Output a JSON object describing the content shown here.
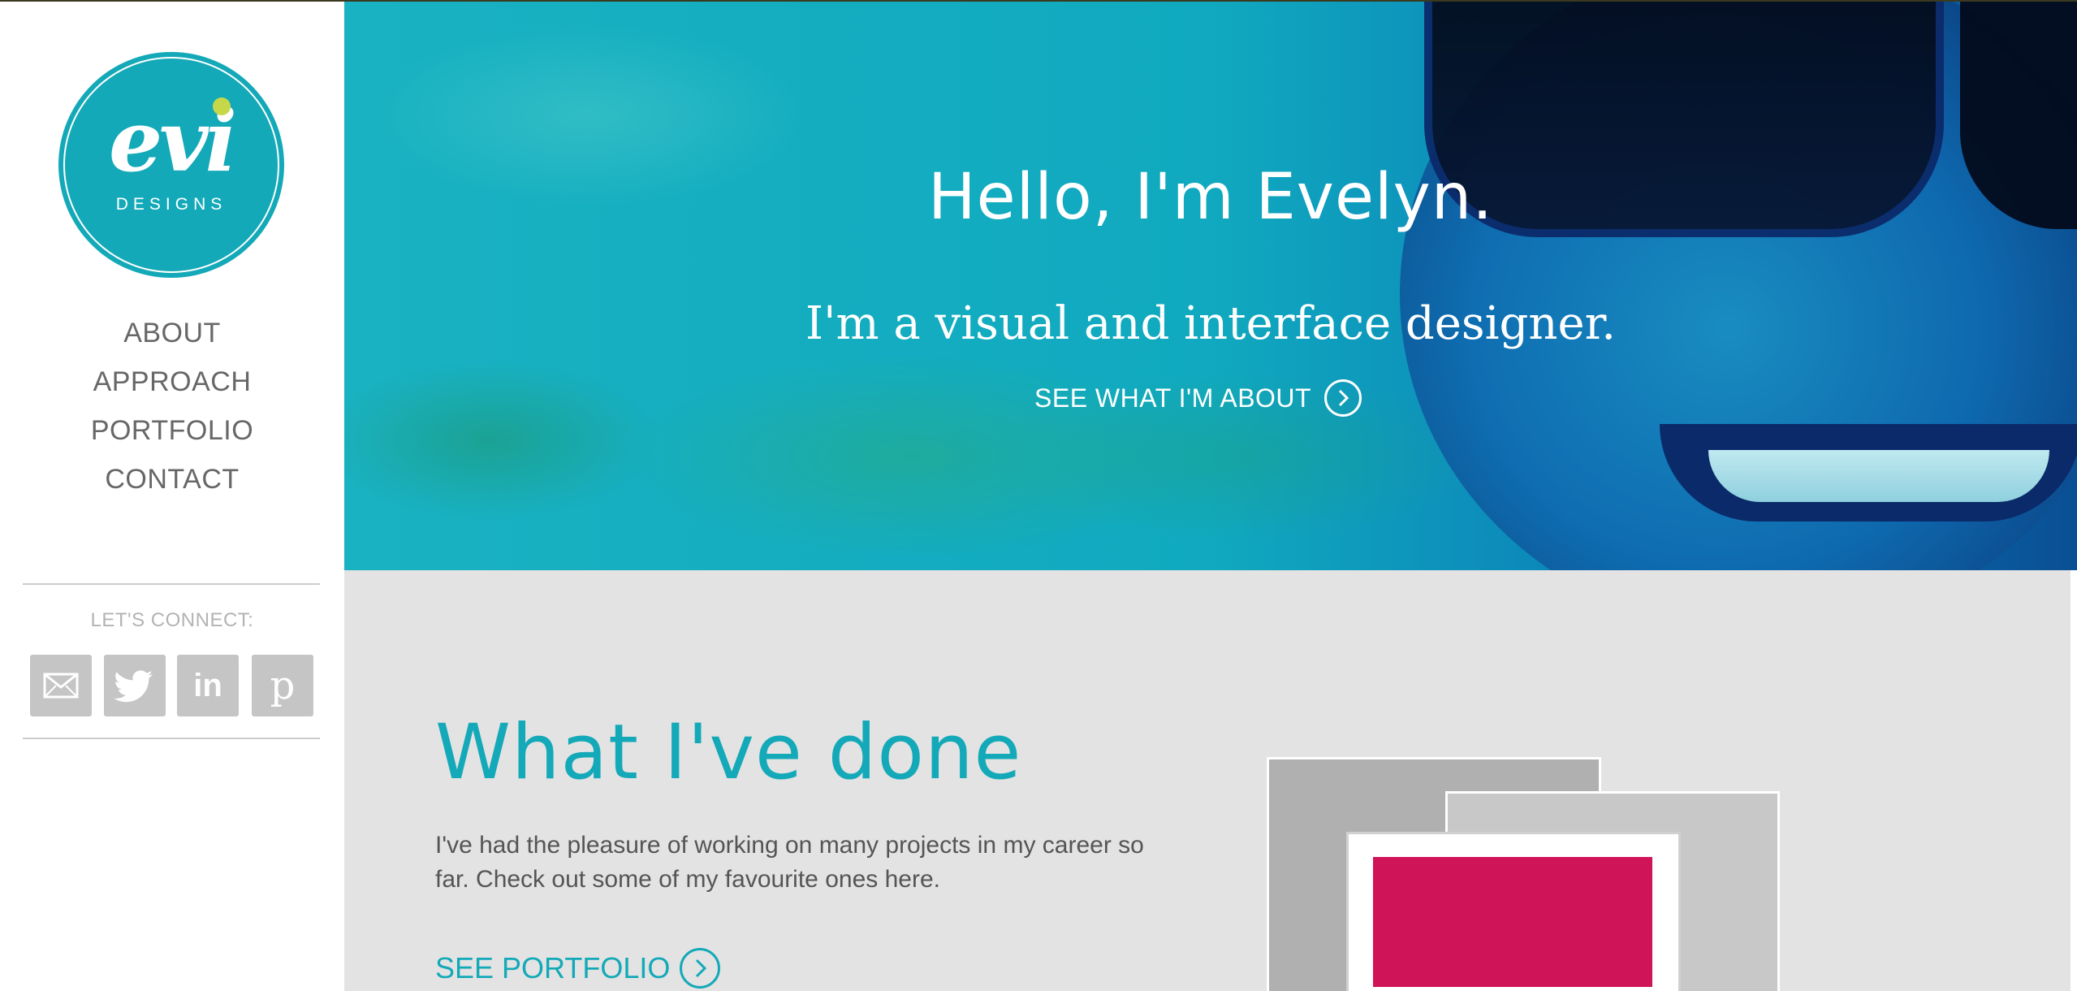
{
  "brand": {
    "logo_mark": "evi",
    "logo_sub": "DESIGNS",
    "primary_color": "#14a9b8",
    "dot_color": "#c6d84a"
  },
  "nav": {
    "items": [
      {
        "label": "ABOUT"
      },
      {
        "label": "APPROACH"
      },
      {
        "label": "PORTFOLIO"
      },
      {
        "label": "CONTACT"
      }
    ]
  },
  "connect": {
    "label": "LET'S CONNECT:",
    "links": [
      {
        "icon": "email-icon"
      },
      {
        "icon": "twitter-icon"
      },
      {
        "icon": "linkedin-icon",
        "text": "in"
      },
      {
        "icon": "pinterest-icon",
        "text": "p"
      }
    ]
  },
  "hero": {
    "title": "Hello, I'm Evelyn.",
    "subtitle": "I'm a visual and interface designer.",
    "cta_label": "SEE WHAT I'M ABOUT"
  },
  "done": {
    "title": "What I've done",
    "body": "I've had the pleasure of working on many projects in my career so far. Check out some of my favourite ones here.",
    "cta_label": "SEE PORTFOLIO",
    "accent_color": "#d01458"
  }
}
